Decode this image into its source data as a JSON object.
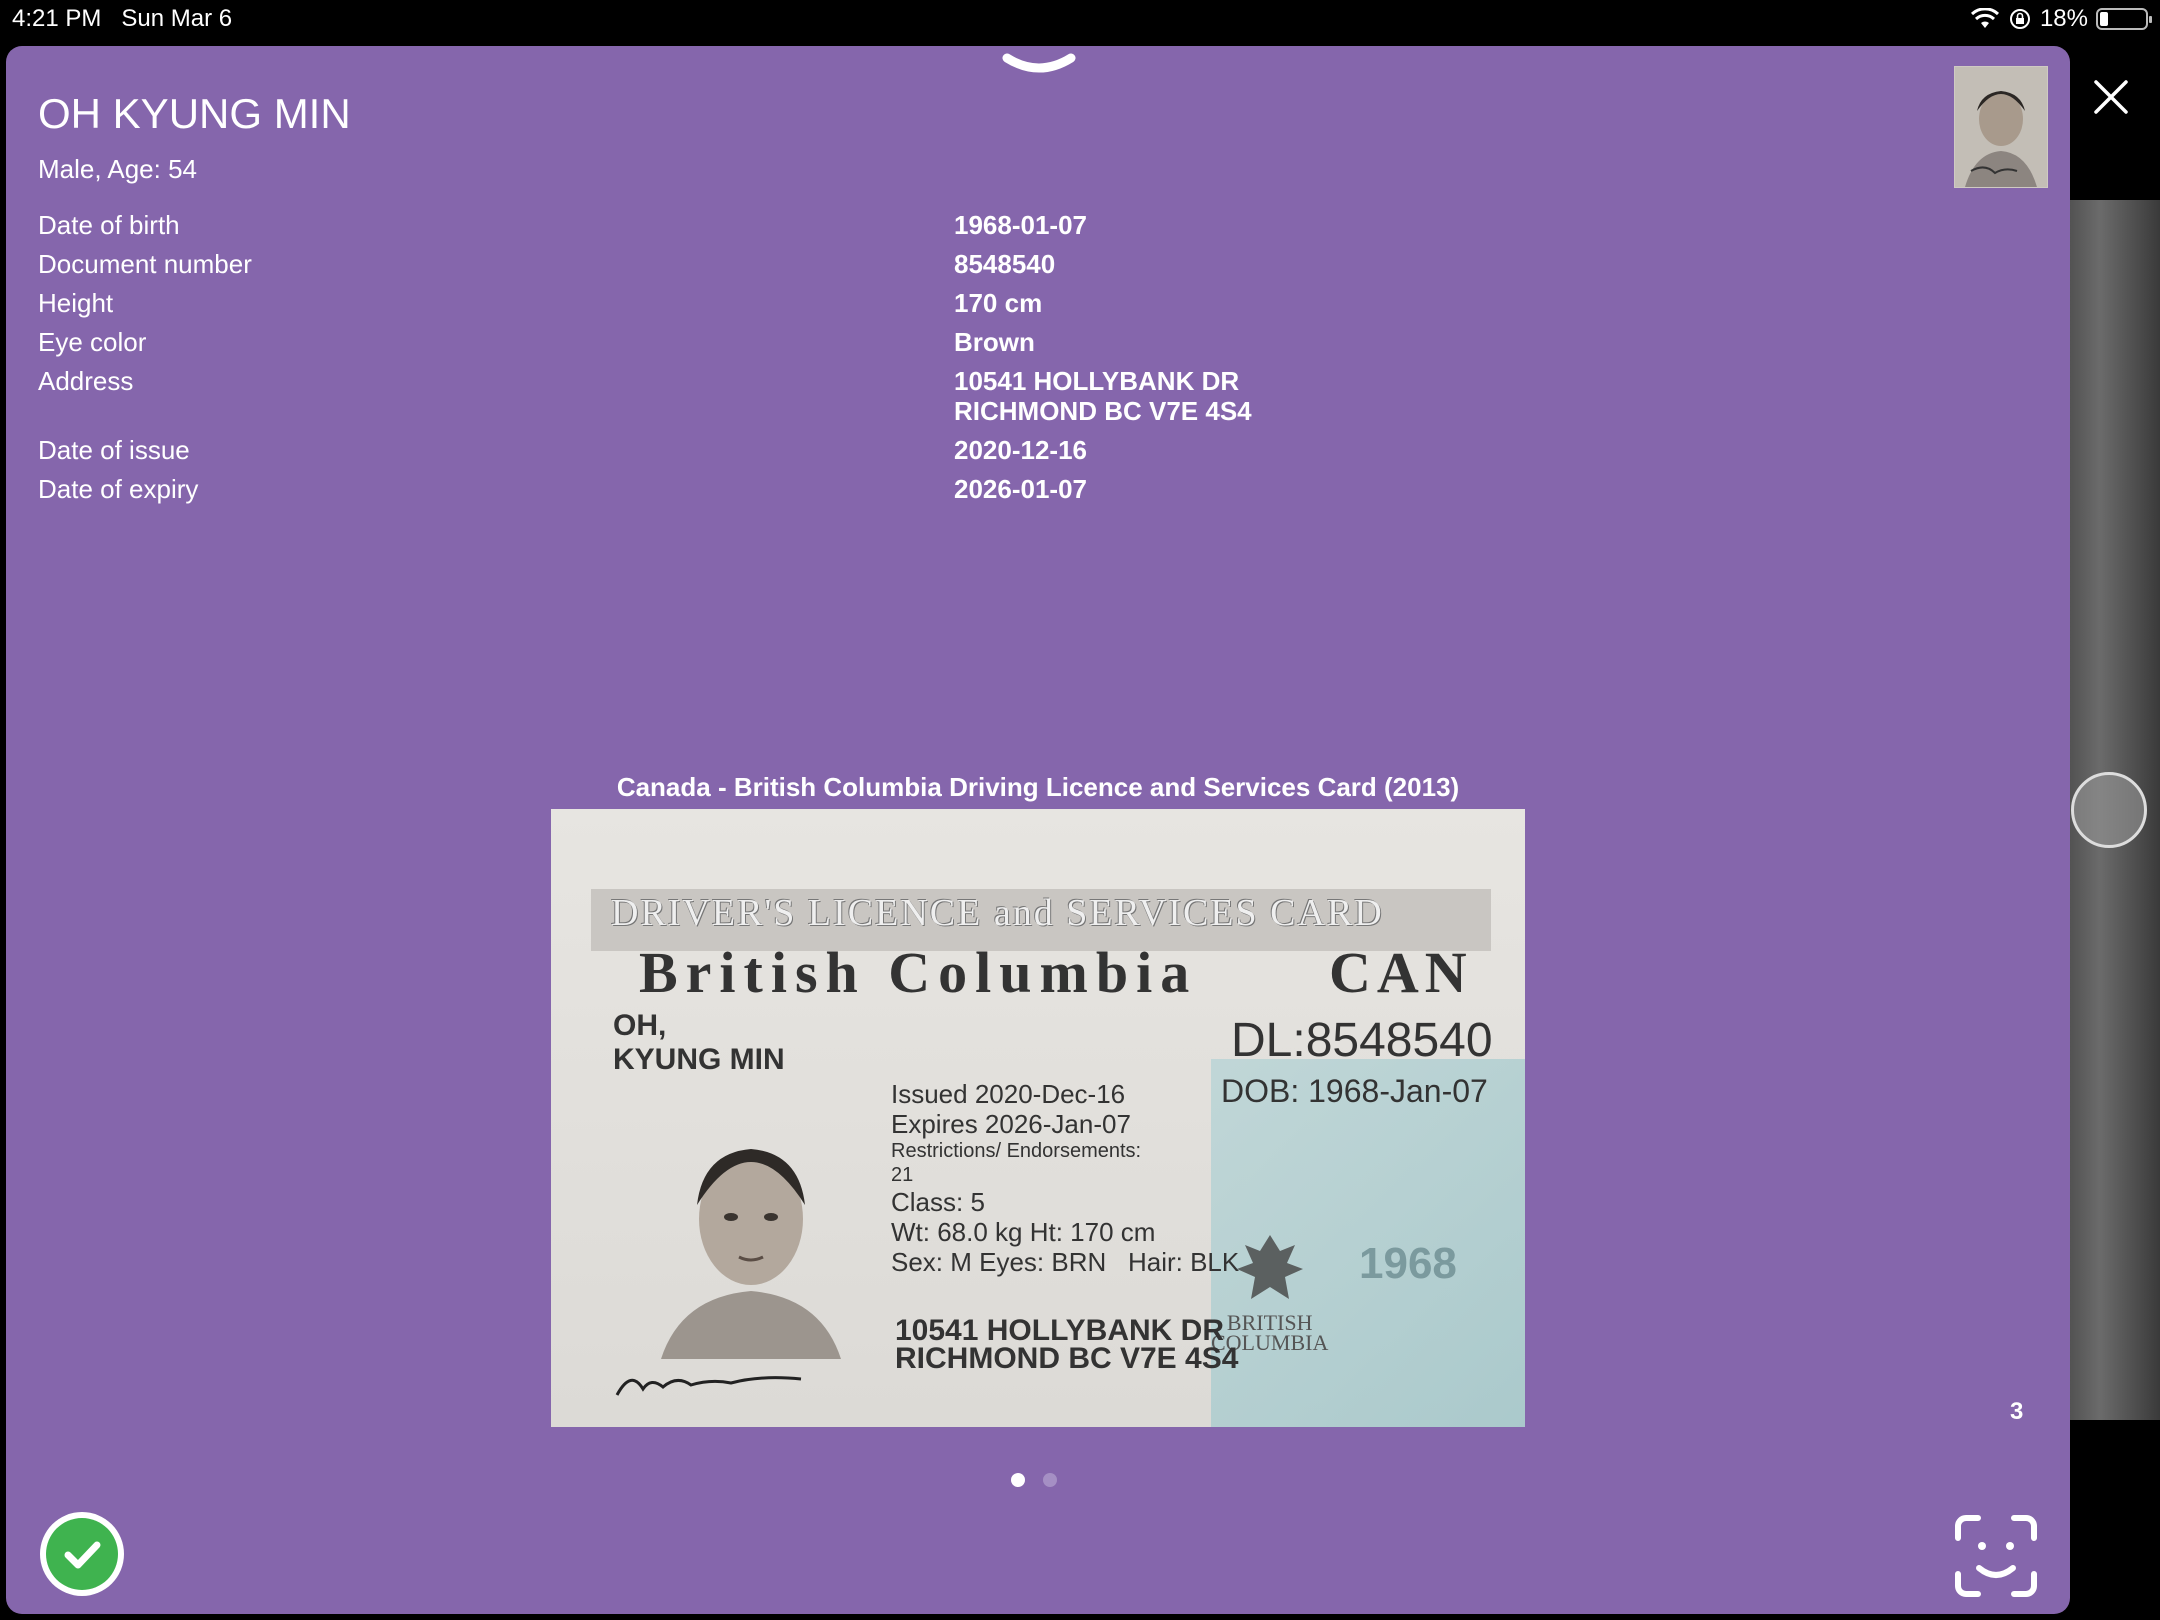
{
  "status": {
    "time": "4:21 PM",
    "date": "Sun Mar 6",
    "battery": "18%",
    "battery_level": 0.18
  },
  "person": {
    "name": "OH KYUNG MIN",
    "summary": "Male, Age: 54"
  },
  "fields": [
    {
      "label": "Date of birth",
      "value": "1968-01-07"
    },
    {
      "label": "Document number",
      "value": "8548540"
    },
    {
      "label": "Height",
      "value": "170 cm"
    },
    {
      "label": "Eye color",
      "value": "Brown"
    },
    {
      "label": "Address",
      "value_line1": "10541 HOLLYBANK DR",
      "value_line2": "RICHMOND BC V7E 4S4"
    },
    {
      "label": "Date of issue",
      "value": "2020-12-16"
    },
    {
      "label": "Date of expiry",
      "value": "2026-01-07"
    }
  ],
  "document": {
    "title": "Canada - British Columbia Driving Licence and Services Card (2013)",
    "page_count": "3",
    "card": {
      "header_line1": "DRIVER'S LICENCE and SERVICES CARD",
      "header_line2": "British Columbia",
      "country": "CAN",
      "name_line1": "OH,",
      "name_line2": "KYUNG MIN",
      "dl": "DL:8548540",
      "issued": "Issued 2020-Dec-16",
      "expires": "Expires 2026-Jan-07",
      "restrictions": "Restrictions/ Endorsements: 21",
      "class": "Class: 5",
      "weight_height": "Wt: 68.0 kg   Ht: 170 cm",
      "sex_eyes": "Sex: M     Eyes: BRN",
      "hair": "Hair: BLK",
      "dob": "DOB: 1968-Jan-07",
      "bc_line1": "BRITISH",
      "bc_line2": "COLUMBIA",
      "year": "1968",
      "address_line1": "10541 HOLLYBANK DR",
      "address_line2": "RICHMOND BC  V7E 4S4"
    }
  },
  "colors": {
    "panel": "#8566ac",
    "confirm": "#3fb34f",
    "background": "#000000"
  },
  "icons": {
    "grabber": "chevron-down-icon",
    "close": "close-icon",
    "confirm": "checkmark-icon",
    "face_scan": "face-scan-icon",
    "wifi": "wifi-icon",
    "lock": "orientation-lock-icon",
    "battery": "battery-icon"
  }
}
